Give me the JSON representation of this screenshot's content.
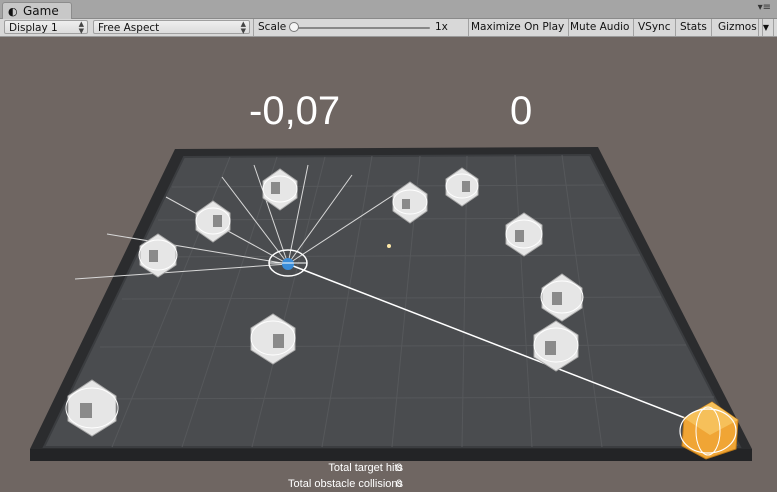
{
  "window": {
    "tab_label": "Game",
    "tab_icon": "game-controller-icon",
    "menu_icon": "window-menu-icon"
  },
  "toolbar": {
    "display": "Display 1",
    "aspect": "Free Aspect",
    "scale_label": "Scale",
    "scale_value": "1x",
    "scale_fraction": 0.0,
    "maximize_on_play": "Maximize On Play",
    "mute_audio": "Mute Audio",
    "vsync": "VSync",
    "stats": "Stats",
    "gizmos": "Gizmos"
  },
  "game": {
    "score_left": "-0,07",
    "score_right": "0",
    "target_hits_label": "Total target hits",
    "target_hits_value": "0",
    "obstacle_collisions_label": "Total obstacle collisions",
    "obstacle_collisions_value": "0",
    "colors": {
      "background": "#6f6662",
      "floor": "#4a4c4f",
      "wall": "#2c2d2f",
      "target": "#f0a535",
      "agent": "#3a8cd8",
      "obstacle": "#f2f2f2"
    }
  }
}
